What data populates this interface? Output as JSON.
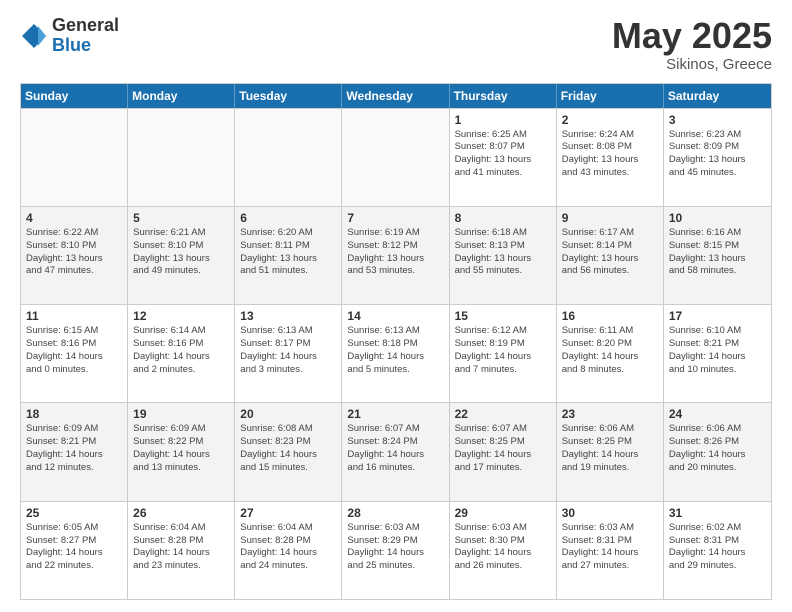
{
  "logo": {
    "general": "General",
    "blue": "Blue"
  },
  "title": {
    "month": "May 2025",
    "location": "Sikinos, Greece"
  },
  "header": {
    "days": [
      "Sunday",
      "Monday",
      "Tuesday",
      "Wednesday",
      "Thursday",
      "Friday",
      "Saturday"
    ]
  },
  "weeks": [
    [
      {
        "day": "",
        "info": "",
        "empty": true
      },
      {
        "day": "",
        "info": "",
        "empty": true
      },
      {
        "day": "",
        "info": "",
        "empty": true
      },
      {
        "day": "",
        "info": "",
        "empty": true
      },
      {
        "day": "1",
        "info": "Sunrise: 6:25 AM\nSunset: 8:07 PM\nDaylight: 13 hours\nand 41 minutes."
      },
      {
        "day": "2",
        "info": "Sunrise: 6:24 AM\nSunset: 8:08 PM\nDaylight: 13 hours\nand 43 minutes."
      },
      {
        "day": "3",
        "info": "Sunrise: 6:23 AM\nSunset: 8:09 PM\nDaylight: 13 hours\nand 45 minutes."
      }
    ],
    [
      {
        "day": "4",
        "info": "Sunrise: 6:22 AM\nSunset: 8:10 PM\nDaylight: 13 hours\nand 47 minutes."
      },
      {
        "day": "5",
        "info": "Sunrise: 6:21 AM\nSunset: 8:10 PM\nDaylight: 13 hours\nand 49 minutes."
      },
      {
        "day": "6",
        "info": "Sunrise: 6:20 AM\nSunset: 8:11 PM\nDaylight: 13 hours\nand 51 minutes."
      },
      {
        "day": "7",
        "info": "Sunrise: 6:19 AM\nSunset: 8:12 PM\nDaylight: 13 hours\nand 53 minutes."
      },
      {
        "day": "8",
        "info": "Sunrise: 6:18 AM\nSunset: 8:13 PM\nDaylight: 13 hours\nand 55 minutes."
      },
      {
        "day": "9",
        "info": "Sunrise: 6:17 AM\nSunset: 8:14 PM\nDaylight: 13 hours\nand 56 minutes."
      },
      {
        "day": "10",
        "info": "Sunrise: 6:16 AM\nSunset: 8:15 PM\nDaylight: 13 hours\nand 58 minutes."
      }
    ],
    [
      {
        "day": "11",
        "info": "Sunrise: 6:15 AM\nSunset: 8:16 PM\nDaylight: 14 hours\nand 0 minutes."
      },
      {
        "day": "12",
        "info": "Sunrise: 6:14 AM\nSunset: 8:16 PM\nDaylight: 14 hours\nand 2 minutes."
      },
      {
        "day": "13",
        "info": "Sunrise: 6:13 AM\nSunset: 8:17 PM\nDaylight: 14 hours\nand 3 minutes."
      },
      {
        "day": "14",
        "info": "Sunrise: 6:13 AM\nSunset: 8:18 PM\nDaylight: 14 hours\nand 5 minutes."
      },
      {
        "day": "15",
        "info": "Sunrise: 6:12 AM\nSunset: 8:19 PM\nDaylight: 14 hours\nand 7 minutes."
      },
      {
        "day": "16",
        "info": "Sunrise: 6:11 AM\nSunset: 8:20 PM\nDaylight: 14 hours\nand 8 minutes."
      },
      {
        "day": "17",
        "info": "Sunrise: 6:10 AM\nSunset: 8:21 PM\nDaylight: 14 hours\nand 10 minutes."
      }
    ],
    [
      {
        "day": "18",
        "info": "Sunrise: 6:09 AM\nSunset: 8:21 PM\nDaylight: 14 hours\nand 12 minutes."
      },
      {
        "day": "19",
        "info": "Sunrise: 6:09 AM\nSunset: 8:22 PM\nDaylight: 14 hours\nand 13 minutes."
      },
      {
        "day": "20",
        "info": "Sunrise: 6:08 AM\nSunset: 8:23 PM\nDaylight: 14 hours\nand 15 minutes."
      },
      {
        "day": "21",
        "info": "Sunrise: 6:07 AM\nSunset: 8:24 PM\nDaylight: 14 hours\nand 16 minutes."
      },
      {
        "day": "22",
        "info": "Sunrise: 6:07 AM\nSunset: 8:25 PM\nDaylight: 14 hours\nand 17 minutes."
      },
      {
        "day": "23",
        "info": "Sunrise: 6:06 AM\nSunset: 8:25 PM\nDaylight: 14 hours\nand 19 minutes."
      },
      {
        "day": "24",
        "info": "Sunrise: 6:06 AM\nSunset: 8:26 PM\nDaylight: 14 hours\nand 20 minutes."
      }
    ],
    [
      {
        "day": "25",
        "info": "Sunrise: 6:05 AM\nSunset: 8:27 PM\nDaylight: 14 hours\nand 22 minutes."
      },
      {
        "day": "26",
        "info": "Sunrise: 6:04 AM\nSunset: 8:28 PM\nDaylight: 14 hours\nand 23 minutes."
      },
      {
        "day": "27",
        "info": "Sunrise: 6:04 AM\nSunset: 8:28 PM\nDaylight: 14 hours\nand 24 minutes."
      },
      {
        "day": "28",
        "info": "Sunrise: 6:03 AM\nSunset: 8:29 PM\nDaylight: 14 hours\nand 25 minutes."
      },
      {
        "day": "29",
        "info": "Sunrise: 6:03 AM\nSunset: 8:30 PM\nDaylight: 14 hours\nand 26 minutes."
      },
      {
        "day": "30",
        "info": "Sunrise: 6:03 AM\nSunset: 8:31 PM\nDaylight: 14 hours\nand 27 minutes."
      },
      {
        "day": "31",
        "info": "Sunrise: 6:02 AM\nSunset: 8:31 PM\nDaylight: 14 hours\nand 29 minutes."
      }
    ]
  ]
}
